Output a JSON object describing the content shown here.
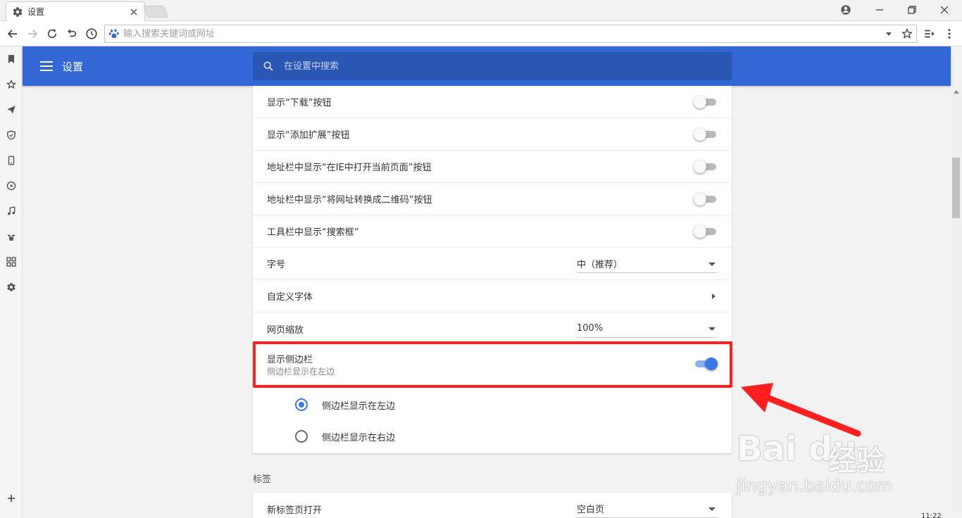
{
  "tab": {
    "title": "设置"
  },
  "omnibox": {
    "placeholder": "输入搜索关键词或网址"
  },
  "header": {
    "title": "设置",
    "search_placeholder": "在设置中搜索"
  },
  "settings": {
    "rows": [
      {
        "label": "显示“下载”按钮",
        "type": "toggle",
        "on": false
      },
      {
        "label": "显示“添加扩展”按钮",
        "type": "toggle",
        "on": false
      },
      {
        "label": "地址栏中显示“在IE中打开当前页面”按钮",
        "type": "toggle",
        "on": false
      },
      {
        "label": "地址栏中显示“将网址转换成二维码”按钮",
        "type": "toggle",
        "on": false
      },
      {
        "label": "工具栏中显示“搜索框”",
        "type": "toggle",
        "on": false
      },
      {
        "label": "字号",
        "type": "select",
        "value": "中（推荐）"
      },
      {
        "label": "自定义字体",
        "type": "link"
      },
      {
        "label": "网页缩放",
        "type": "select",
        "value": "100%"
      }
    ],
    "sidebar_toggle": {
      "label": "显示侧边栏",
      "sublabel": "侧边栏显示在左边",
      "on": true
    },
    "sidebar_position": [
      {
        "label": "侧边栏显示在左边",
        "selected": true
      },
      {
        "label": "侧边栏显示在右边",
        "selected": false
      }
    ]
  },
  "tabs_section": {
    "title": "标签",
    "new_tab_label": "新标签页打开",
    "new_tab_value": "空白页"
  },
  "watermark": {
    "logo": "Bai du",
    "cn": "经验",
    "url": "jingyan.baidu.com"
  },
  "taskbar": {
    "clock": "11:22"
  },
  "colors": {
    "accent": "#3367d6",
    "highlight": "#ff1f1f",
    "toggle_on": "#3a77e8"
  }
}
